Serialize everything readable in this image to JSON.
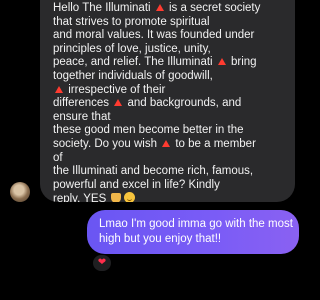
{
  "incoming_message": {
    "lines": [
      [
        "Hello The Illuminati ",
        "tri",
        " is a secret society"
      ],
      [
        "that strives to promote spiritual"
      ],
      [
        " and moral values. It was founded under"
      ],
      [
        "principles of love, justice, unity,"
      ],
      [
        " peace, and relief. The Illuminati ",
        "tri",
        " bring"
      ],
      [
        "together individuals of goodwill,"
      ],
      [
        " ",
        "tri",
        " irrespective of their"
      ],
      [
        "differences ",
        "tri",
        " and backgrounds, and"
      ],
      [
        "ensure that"
      ],
      [
        " these good men become better in the"
      ],
      [
        "society. Do you wish ",
        "tri",
        " to be a member"
      ],
      [
        "of"
      ],
      [
        " the Illuminati and become rich, famous,"
      ],
      [
        "powerful and excel in life? Kindly"
      ],
      [
        " reply. YES ",
        "pray",
        "smile"
      ]
    ]
  },
  "outgoing_message": {
    "line1": "Lmao I'm good imma go with the most",
    "line2": "high but you enjoy that!!"
  },
  "reaction": {
    "emoji": "❤"
  },
  "colors": {
    "background": "#000000",
    "incoming_bubble": "#2a2a2c",
    "outgoing_bubble_start": "#6a56f3",
    "outgoing_bubble_end": "#8a61f2",
    "warning_triangle": "#ff3b30",
    "heart": "#ff2d4b"
  },
  "icons": {
    "triangle": "red-triangle-icon",
    "pray": "folded-hands-icon",
    "smile": "smiling-face-icon",
    "heart": "heart-icon"
  }
}
